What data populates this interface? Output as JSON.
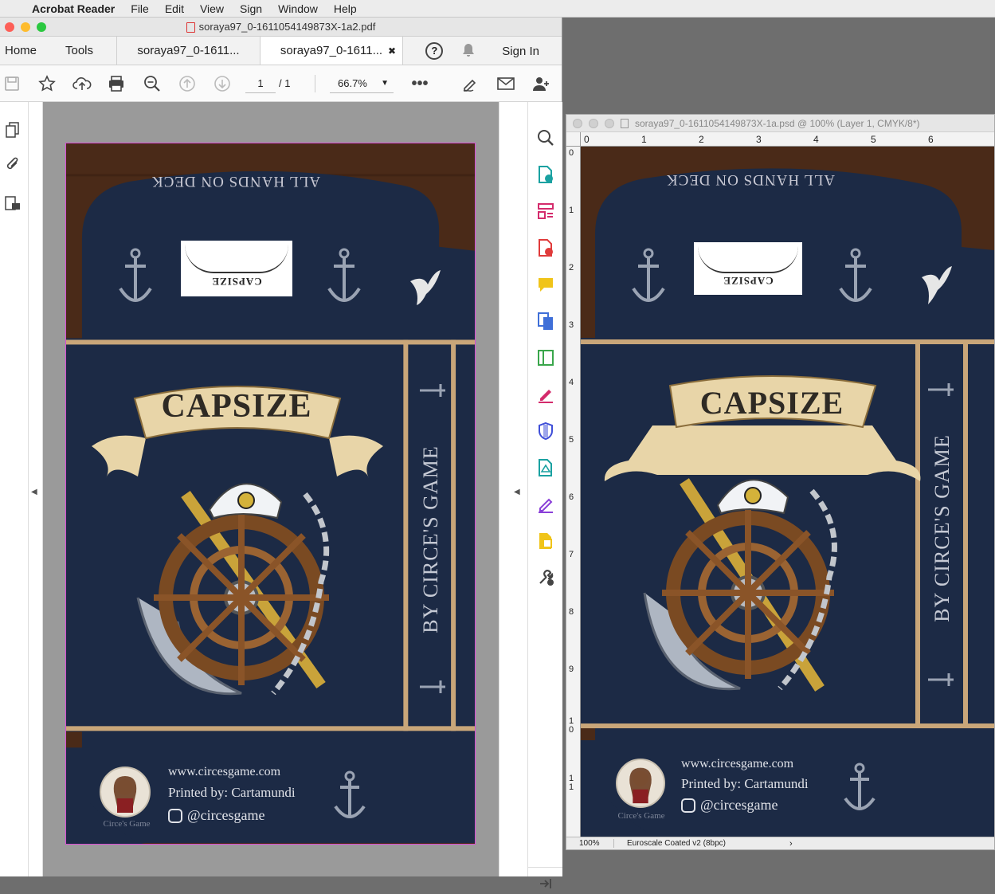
{
  "menubar": {
    "app_name": "Acrobat Reader",
    "items": [
      "File",
      "Edit",
      "View",
      "Sign",
      "Window",
      "Help"
    ]
  },
  "acrobat": {
    "window_title": "soraya97_0-1611054149873X-1a2.pdf",
    "tabs": {
      "home": "Home",
      "tools": "Tools",
      "doc1": "soraya97_0-1611...",
      "doc2": "soraya97_0-1611..."
    },
    "sign_in": "Sign In",
    "page_current": "1",
    "page_total": "/ 1",
    "zoom": "66.7%"
  },
  "artwork": {
    "arc_text": "ALL HANDS ON DECK",
    "stamp_text": "CAPSIZE",
    "banner_title": "CAPSIZE",
    "side_text": "BY CIRCE'S GAME",
    "website": "www.circesgame.com",
    "printer": "Printed by: Cartamundi",
    "instagram": "@circesgame",
    "logo_caption": "Circe's Game"
  },
  "psd": {
    "window_title": "soraya97_0-1611054149873X-1a.psd @ 100% (Layer 1, CMYK/8*)",
    "ruler_h": [
      "0",
      "1",
      "2",
      "3",
      "4",
      "5",
      "6"
    ],
    "ruler_v": [
      "0",
      "1",
      "2",
      "3",
      "4",
      "5",
      "6",
      "7",
      "8",
      "9",
      "1\n0",
      "1\n1"
    ],
    "status_zoom": "100%",
    "status_profile": "Euroscale Coated v2 (8bpc)"
  },
  "colors": {
    "navy": "#1c2a45",
    "wood": "#4a2a18",
    "rope": "#c9a679",
    "parchment": "#e8d5a8"
  }
}
